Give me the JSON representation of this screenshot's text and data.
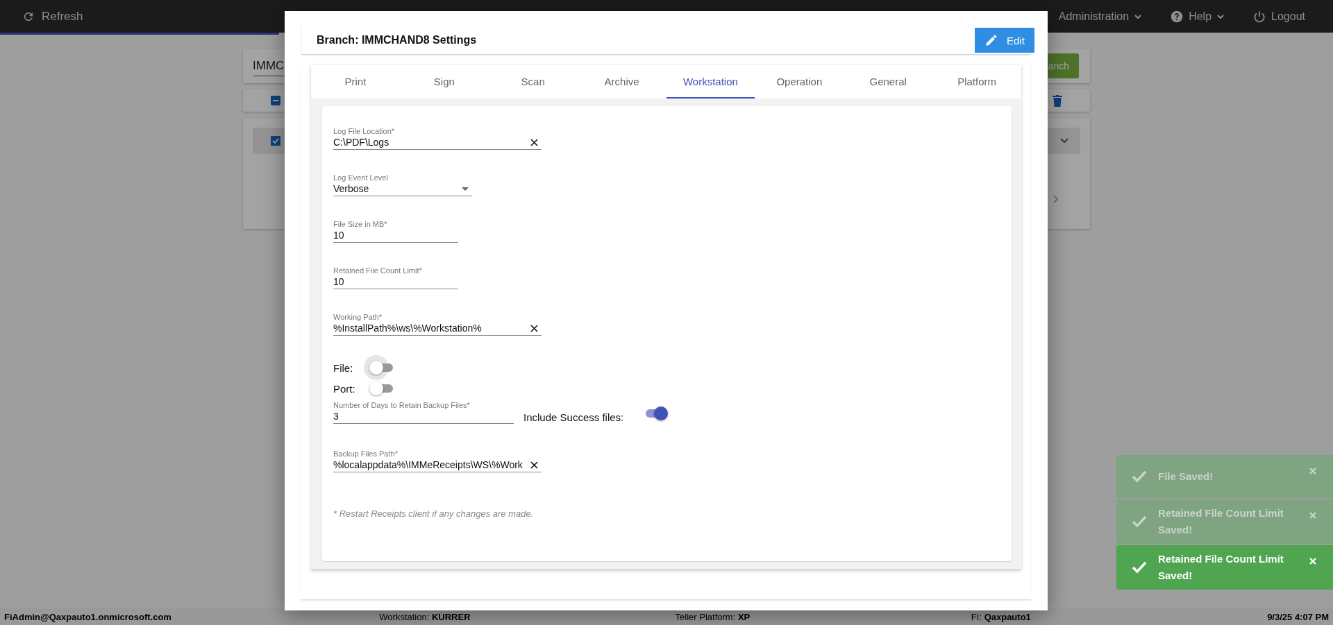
{
  "top_bar": {
    "refresh": "Refresh",
    "menus": [
      {
        "kind": "admin",
        "label": "Administration"
      },
      {
        "kind": "help",
        "label": "Help"
      },
      {
        "kind": "logout",
        "label": "Logout"
      }
    ]
  },
  "background": {
    "search_value": "IMMC",
    "search_button": "anch",
    "select_all_indeterminate": true,
    "row_checked": true
  },
  "dialog": {
    "title": "Branch: IMMCHAND8 Settings",
    "edit_button": "Edit",
    "tabs": [
      {
        "label": "Print",
        "selected": false
      },
      {
        "label": "Sign",
        "selected": false
      },
      {
        "label": "Scan",
        "selected": false
      },
      {
        "label": "Archive",
        "selected": false
      },
      {
        "label": "Workstation",
        "selected": true
      },
      {
        "label": "Operation",
        "selected": false
      },
      {
        "label": "General",
        "selected": false
      },
      {
        "label": "Platform",
        "selected": false
      }
    ],
    "fields": [
      {
        "kind": "text",
        "label": "Log File Location*",
        "value": "C:\\PDF\\Logs"
      },
      {
        "kind": "select",
        "label": "Log Event Level",
        "value": "Verbose"
      },
      {
        "kind": "number",
        "label": "File Size in MB*",
        "value": "10"
      },
      {
        "kind": "number",
        "label": "Retained File Count Limit*",
        "value": "10"
      },
      {
        "kind": "text",
        "label": "Working Path*",
        "value": "%InstallPath%\\ws\\%Workstation%"
      },
      {
        "kind": "switch",
        "label": "File:",
        "on": false,
        "focused": true
      },
      {
        "kind": "switch",
        "label": "Port:",
        "on": false,
        "focused": false
      },
      {
        "kind": "number-switch",
        "label": "Number of Days to Retain Backup Files*",
        "value": "3",
        "switch_label": "Include Success files:",
        "on": true
      },
      {
        "kind": "text",
        "label": "Backup Files Path*",
        "value": "%localappdata%\\IMMeReceipts\\WS\\%Work"
      }
    ],
    "note": "* Restart Receipts client if any changes are made."
  },
  "toasts": [
    {
      "text": "File Saved!",
      "faded": true
    },
    {
      "text": "Retained File Count Limit Saved!",
      "faded": true
    },
    {
      "text": "Retained File Count Limit Saved!",
      "faded": false
    }
  ],
  "footer": {
    "user": "FiAdmin@Qaxpauto1.onmicrosoft.com",
    "items": [
      {
        "label": "Workstation:",
        "value": "KURRER"
      },
      {
        "label": "Teller Platform:",
        "value": "XP"
      },
      {
        "label": "FI:",
        "value": "Qaxpauto1"
      }
    ],
    "time": "9/3/25 4:07 PM"
  }
}
